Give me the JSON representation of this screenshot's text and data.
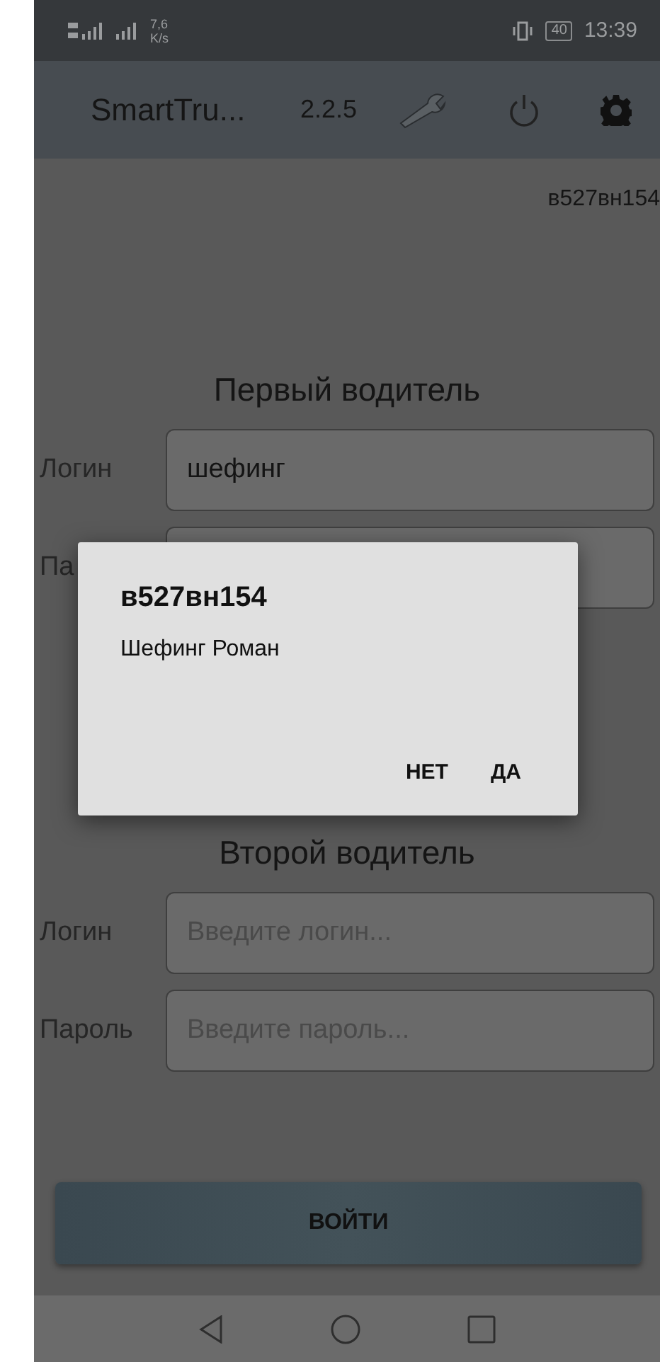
{
  "status_bar": {
    "speed_value": "7,6",
    "speed_unit": "K/s",
    "battery": "40",
    "time": "13:39"
  },
  "app_bar": {
    "title": "SmartTru...",
    "version": "2.2.5"
  },
  "vehicle_number": "в527вн154",
  "drivers": [
    {
      "heading": "Первый водитель",
      "fields": [
        {
          "label": "Логин",
          "value": "шефинг"
        },
        {
          "label": "Па"
        }
      ]
    },
    {
      "heading": "Второй водитель",
      "fields": [
        {
          "label": "Логин",
          "placeholder": "Введите логин..."
        },
        {
          "label": "Пароль",
          "placeholder": "Введите пароль..."
        }
      ]
    }
  ],
  "login_button": "ВОЙТИ",
  "dialog": {
    "title": "в527вн154",
    "message": "Шефинг Роман",
    "buttons": [
      "НЕТ",
      "ДА"
    ]
  }
}
